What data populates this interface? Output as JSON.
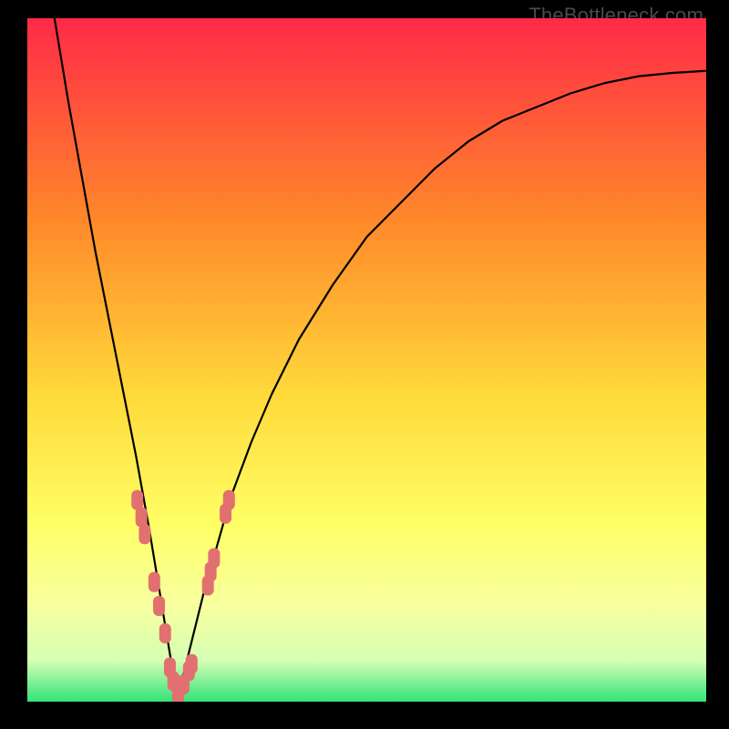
{
  "watermark": "TheBottleneck.com",
  "colors": {
    "frame": "#000000",
    "grad_top": "#ff2a47",
    "grad_mid1": "#ff8a2a",
    "grad_mid2": "#ffd93a",
    "grad_mid3": "#ffff66",
    "grad_low1": "#f7ffa0",
    "grad_low2": "#d6ffb3",
    "grad_bottom": "#32e27a",
    "curve": "#000000",
    "series": "#e27070"
  },
  "chart_data": {
    "type": "line",
    "title": "",
    "xlabel": "",
    "ylabel": "",
    "xlim": [
      0,
      100
    ],
    "ylim": [
      0,
      100
    ],
    "curve": {
      "description": "V-shaped bottleneck curve; minimum at x≈22",
      "x": [
        4,
        6,
        8,
        10,
        12,
        14,
        16,
        18,
        19,
        20,
        21,
        22,
        23,
        24,
        25,
        26,
        28,
        30,
        33,
        36,
        40,
        45,
        50,
        55,
        60,
        65,
        70,
        75,
        80,
        85,
        90,
        95,
        100
      ],
      "y": [
        100,
        88,
        77,
        66,
        56,
        46,
        36,
        25,
        19,
        13,
        7,
        1,
        4,
        8,
        12,
        16,
        23,
        30,
        38,
        45,
        53,
        61,
        68,
        73,
        78,
        82,
        85,
        87,
        89,
        90.5,
        91.5,
        92,
        92.3
      ]
    },
    "series": [
      {
        "name": "data-points",
        "marker": "rounded-rect",
        "color": "#e27070",
        "points": [
          {
            "x": 16.2,
            "y": 29.5
          },
          {
            "x": 16.8,
            "y": 27.0
          },
          {
            "x": 17.3,
            "y": 24.5
          },
          {
            "x": 18.7,
            "y": 17.5
          },
          {
            "x": 19.4,
            "y": 14.0
          },
          {
            "x": 20.3,
            "y": 10.0
          },
          {
            "x": 21.0,
            "y": 5.0
          },
          {
            "x": 21.5,
            "y": 3.0
          },
          {
            "x": 22.2,
            "y": 1.0
          },
          {
            "x": 23.0,
            "y": 2.5
          },
          {
            "x": 23.8,
            "y": 4.5
          },
          {
            "x": 24.2,
            "y": 5.5
          },
          {
            "x": 26.6,
            "y": 17.0
          },
          {
            "x": 27.0,
            "y": 19.0
          },
          {
            "x": 27.5,
            "y": 21.0
          },
          {
            "x": 29.2,
            "y": 27.5
          },
          {
            "x": 29.7,
            "y": 29.5
          }
        ]
      }
    ]
  }
}
